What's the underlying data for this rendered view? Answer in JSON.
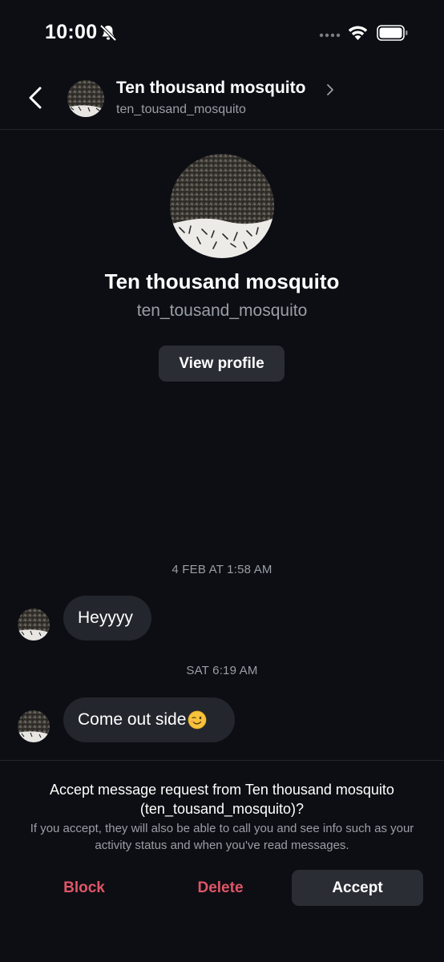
{
  "status_bar": {
    "time": "10:00",
    "icons": [
      "bell-slash-icon",
      "signal-icon",
      "wifi-icon",
      "battery-icon"
    ]
  },
  "header": {
    "name": "Ten thousand mosquito",
    "username": "ten_tousand_mosquito",
    "icons": [
      "chevron-left-icon",
      "chevron-right-icon"
    ]
  },
  "profile": {
    "name": "Ten thousand mosquito",
    "username": "ten_tousand_mosquito",
    "view_profile_label": "View profile"
  },
  "messages": [
    {
      "timestamp": "4 FEB AT 1:58 AM",
      "text": "Heyyyy"
    },
    {
      "timestamp": "SAT 6:19 AM",
      "text": "Come out side",
      "emoji": "winking-face-icon"
    }
  ],
  "request": {
    "title": "Accept message request from Ten thousand mosquito (ten_tousand_mosquito)?",
    "subtitle": "If you accept, they will also be able to call you and see info such as your activity status and when you've read messages.",
    "block_label": "Block",
    "delete_label": "Delete",
    "accept_label": "Accept"
  },
  "colors": {
    "background": "#0c0e13",
    "bubble": "#23262d",
    "button": "#2a2d34",
    "secondary_text": "#9a9ea6",
    "destructive": "#e05567"
  }
}
